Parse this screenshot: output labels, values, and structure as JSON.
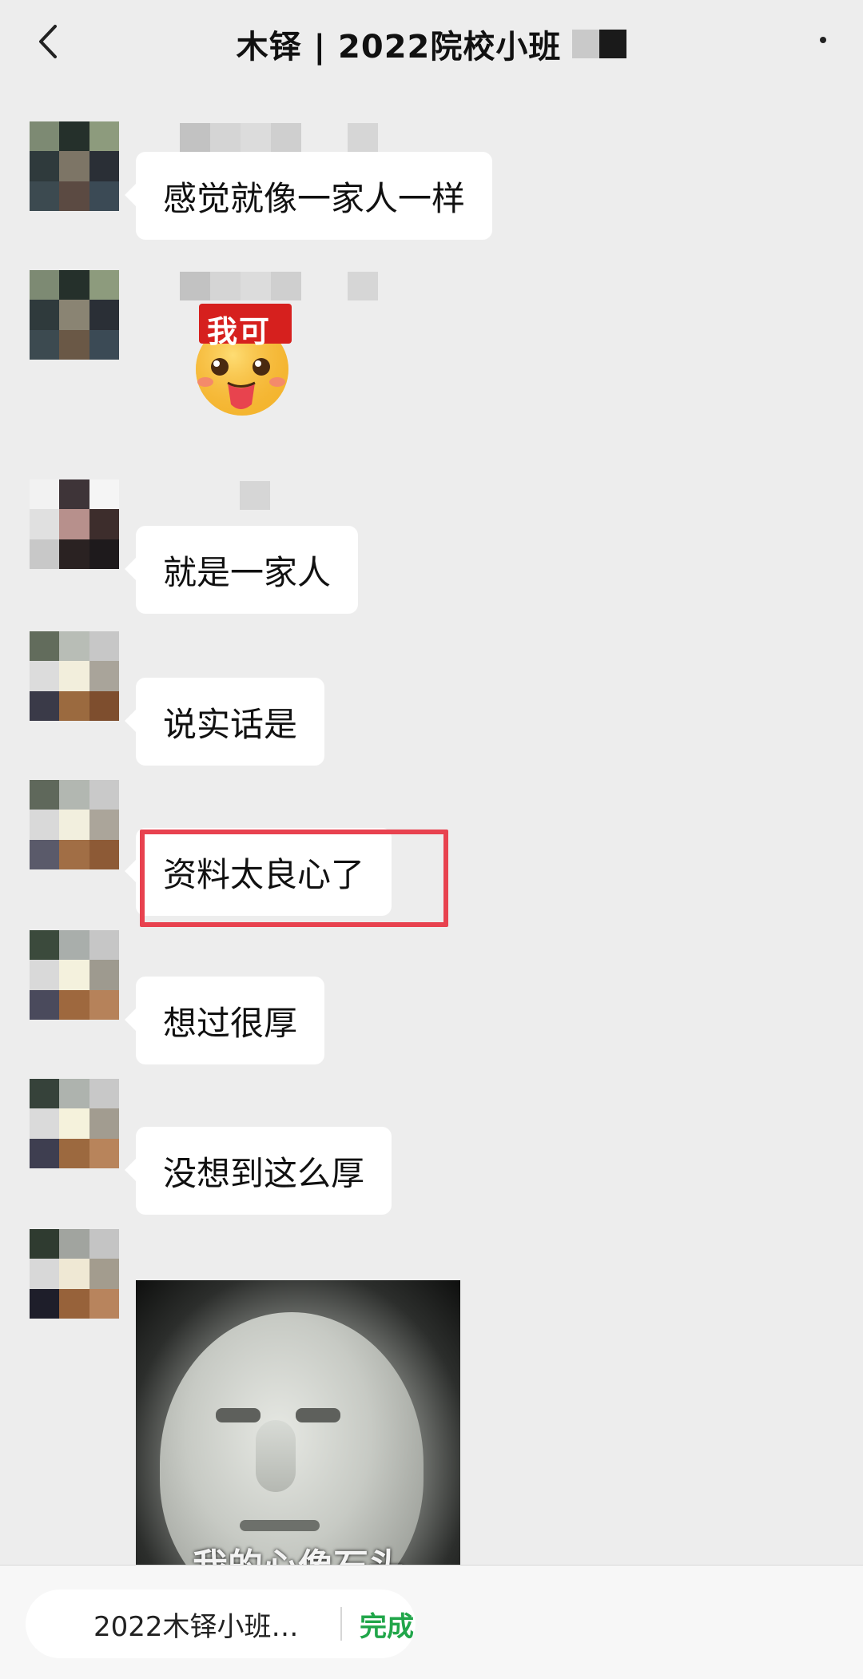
{
  "header": {
    "title": "木铎 | 2022院校小班",
    "back_icon": "chevron-left-icon",
    "more_icon": "dot-menu-icon"
  },
  "messages": [
    {
      "type": "text",
      "text": "感觉就像一家人一样"
    },
    {
      "type": "sticker",
      "sticker_text": "我可"
    },
    {
      "type": "text",
      "text": "就是一家人"
    },
    {
      "type": "text",
      "text": "说实话是"
    },
    {
      "type": "text",
      "text": "资料太良心了",
      "highlighted": true
    },
    {
      "type": "text",
      "text": "想过很厚"
    },
    {
      "type": "text",
      "text": "没想到这么厚"
    },
    {
      "type": "image",
      "caption": "我的心像石头"
    }
  ],
  "bottom_bar": {
    "label": "2022木铎小班…",
    "done_label": "完成"
  },
  "colors": {
    "background": "#ededed",
    "bubble": "#ffffff",
    "highlight": "#e8424f",
    "done": "#21a64a"
  }
}
